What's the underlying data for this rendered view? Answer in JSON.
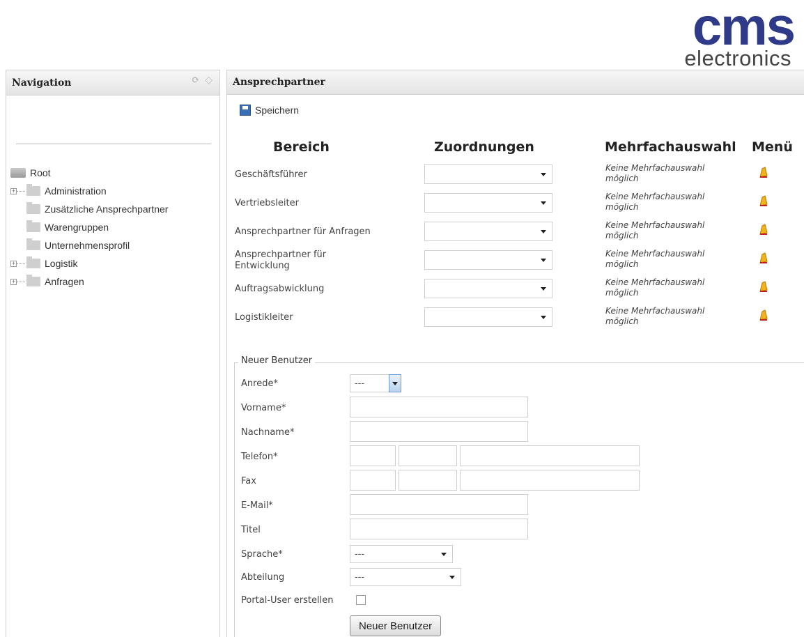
{
  "logo": {
    "main": "cms",
    "sub": "electronics"
  },
  "nav": {
    "title": "Navigation",
    "tree": [
      {
        "label": "Root",
        "level": 0,
        "type": "root"
      },
      {
        "label": "Administration",
        "level": 1,
        "expandable": true
      },
      {
        "label": "Zusätzliche Ansprechpartner",
        "level": 1,
        "expandable": false
      },
      {
        "label": "Warengruppen",
        "level": 1,
        "expandable": false
      },
      {
        "label": "Unternehmensprofil",
        "level": 1,
        "expandable": false
      },
      {
        "label": "Logistik",
        "level": 1,
        "expandable": true
      },
      {
        "label": "Anfragen",
        "level": 1,
        "expandable": true
      }
    ]
  },
  "main": {
    "title": "Ansprechpartner",
    "save_label": "Speichern",
    "columns": {
      "bereich": "Bereich",
      "zuordnungen": "Zuordnungen",
      "mehrfach": "Mehrfachauswahl",
      "menu": "Menü"
    },
    "rows": [
      {
        "label": "Geschäftsführer",
        "note": "Keine Mehrfachauswahl möglich"
      },
      {
        "label": "Vertriebsleiter",
        "note": "Keine Mehrfachauswahl möglich"
      },
      {
        "label": "Ansprechpartner für Anfragen",
        "note": "Keine Mehrfachauswahl möglich"
      },
      {
        "label": "Ansprechpartner für Entwicklung",
        "note": "Keine Mehrfachauswahl möglich"
      },
      {
        "label": "Auftragsabwicklung",
        "note": "Keine Mehrfachauswahl möglich"
      },
      {
        "label": "Logistikleiter",
        "note": "Keine Mehrfachauswahl möglich"
      }
    ]
  },
  "new_user": {
    "legend": "Neuer Benutzer",
    "anrede_label": "Anrede*",
    "anrede_value": "---",
    "vorname_label": "Vorname*",
    "nachname_label": "Nachname*",
    "telefon_label": "Telefon*",
    "fax_label": "Fax",
    "email_label": "E-Mail*",
    "titel_label": "Titel",
    "sprache_label": "Sprache*",
    "sprache_value": "---",
    "abteilung_label": "Abteilung",
    "abteilung_value": "---",
    "portal_label": "Portal-User erstellen",
    "submit_label": "Neuer Benutzer"
  },
  "colors": {
    "brand": "#2f3b88",
    "accent": "#3a6fb5"
  }
}
